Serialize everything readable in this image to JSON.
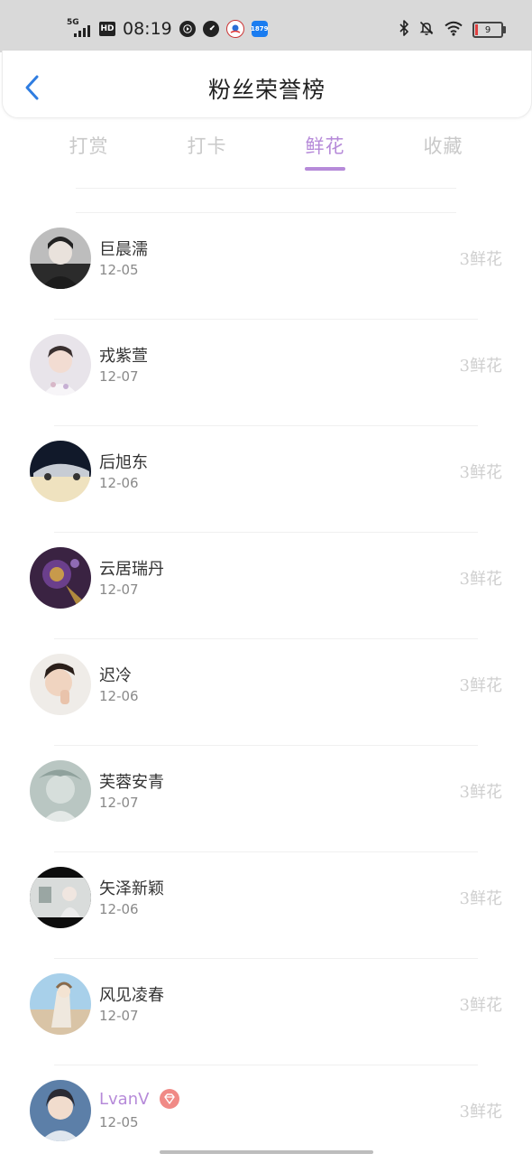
{
  "status_bar": {
    "network": "5G",
    "hd": "HD",
    "time": "08:19",
    "battery": "9",
    "battery_color": "#e04040",
    "app_icons": [
      "media-play-icon",
      "speedometer-icon",
      "map-app-icon",
      "blue-app-icon"
    ],
    "blue_app_text": "1879"
  },
  "header": {
    "title": "粉丝荣誉榜",
    "back_icon": "chevron-left-icon",
    "accent_color": "#2f7de1"
  },
  "tabs": [
    {
      "label": "打赏",
      "active": false
    },
    {
      "label": "打卡",
      "active": false
    },
    {
      "label": "鲜花",
      "active": true
    },
    {
      "label": "收藏",
      "active": false
    }
  ],
  "tab_active_color": "#b68ad9",
  "fans": [
    {
      "name": "巨晨濡",
      "date": "12-05",
      "gift": "3鲜花",
      "vip": false
    },
    {
      "name": "戎紫萱",
      "date": "12-07",
      "gift": "3鲜花",
      "vip": false
    },
    {
      "name": "后旭东",
      "date": "12-06",
      "gift": "3鲜花",
      "vip": false
    },
    {
      "name": "云居瑞丹",
      "date": "12-07",
      "gift": "3鲜花",
      "vip": false
    },
    {
      "name": "迟冷",
      "date": "12-06",
      "gift": "3鲜花",
      "vip": false
    },
    {
      "name": "芙蓉安青",
      "date": "12-07",
      "gift": "3鲜花",
      "vip": false
    },
    {
      "name": "矢泽新颖",
      "date": "12-06",
      "gift": "3鲜花",
      "vip": false
    },
    {
      "name": "风见凌春",
      "date": "12-07",
      "gift": "3鲜花",
      "vip": false
    },
    {
      "name": "LvanV",
      "date": "12-05",
      "gift": "3鲜花",
      "vip": true
    }
  ]
}
